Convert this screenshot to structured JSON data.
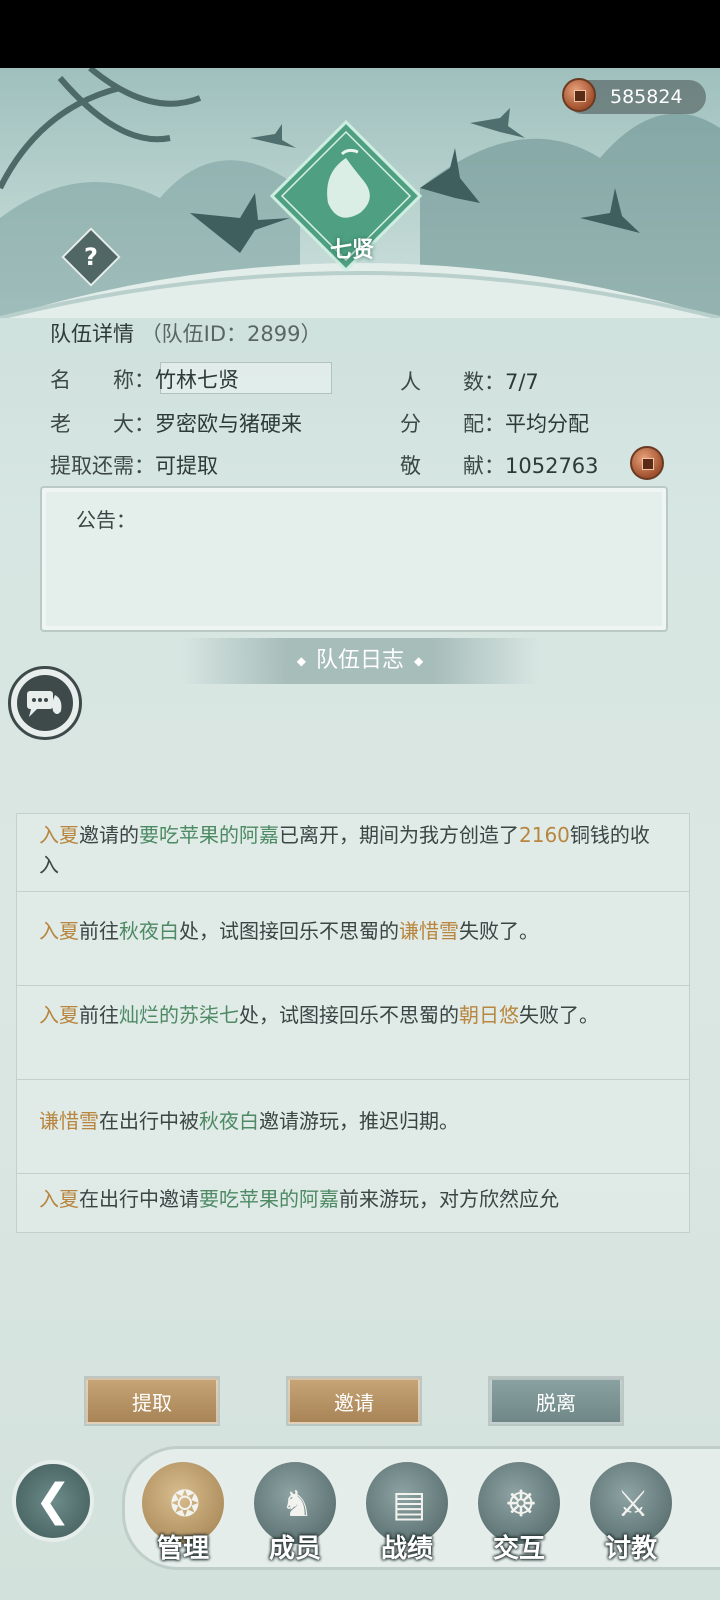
{
  "currency": {
    "amount": "585824"
  },
  "emblem": {
    "name": "七贤"
  },
  "team": {
    "title": "队伍详情",
    "id_text": "（队伍ID：2899）",
    "name_label": "名　　称：",
    "name_value": "竹林七贤",
    "count_label": "人　　数：",
    "count_value": "7/7",
    "leader_label": "老　　大：",
    "leader_value": "罗密欧与猪硬来",
    "distribution_label": "分　　配：",
    "distribution_value": "平均分配",
    "withdraw_label": "提取还需：",
    "withdraw_value": "可提取",
    "contribution_label": "敬　　献：",
    "contribution_value": "1052763"
  },
  "notice": {
    "label": "公告："
  },
  "log": {
    "title": "队伍日志",
    "entries": [
      {
        "parts": [
          {
            "t": "入夏",
            "c": "o"
          },
          {
            "t": "邀请的"
          },
          {
            "t": "要吃苹果的阿嘉",
            "c": "g"
          },
          {
            "t": "已离开，期间为我方创造了"
          },
          {
            "t": "2160",
            "c": "o"
          },
          {
            "t": "铜钱的收入"
          }
        ]
      },
      {
        "parts": [
          {
            "t": "入夏",
            "c": "o"
          },
          {
            "t": "前往"
          },
          {
            "t": "秋夜白",
            "c": "g"
          },
          {
            "t": "处，试图接回乐不思蜀的"
          },
          {
            "t": "谦惜雪",
            "c": "o"
          },
          {
            "t": "失败了。"
          }
        ]
      },
      {
        "parts": [
          {
            "t": "入夏",
            "c": "o"
          },
          {
            "t": "前往"
          },
          {
            "t": "灿烂的苏柒七",
            "c": "g"
          },
          {
            "t": "处，试图接回乐不思蜀的"
          },
          {
            "t": "朝日悠",
            "c": "o"
          },
          {
            "t": "失败了。"
          }
        ]
      },
      {
        "parts": [
          {
            "t": "谦惜雪",
            "c": "o"
          },
          {
            "t": "在出行中被"
          },
          {
            "t": "秋夜白",
            "c": "g"
          },
          {
            "t": "邀请游玩，推迟归期。"
          }
        ]
      },
      {
        "parts": [
          {
            "t": "入夏",
            "c": "o"
          },
          {
            "t": "在出行中邀请"
          },
          {
            "t": "要吃苹果的阿嘉",
            "c": "g"
          },
          {
            "t": "前来游玩，对方欣然应允"
          }
        ]
      }
    ]
  },
  "actions": {
    "withdraw": "提取",
    "invite": "邀请",
    "leave": "脱离"
  },
  "tabs": [
    {
      "label": "管理",
      "icon": "manage-icon"
    },
    {
      "label": "成员",
      "icon": "members-icon"
    },
    {
      "label": "战绩",
      "icon": "records-icon"
    },
    {
      "label": "交互",
      "icon": "interact-icon"
    },
    {
      "label": "讨教",
      "icon": "duel-icon"
    }
  ],
  "colors": {
    "orange_name": "#b8863e",
    "green_name": "#4d8a64",
    "gold_button": "#b8946a",
    "grey_button": "#7b9393"
  }
}
